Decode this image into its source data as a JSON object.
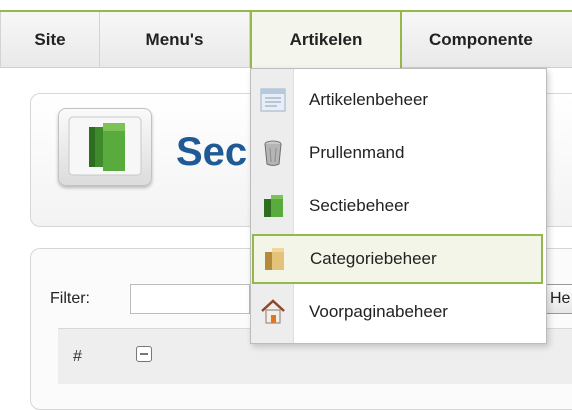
{
  "menubar": {
    "items": [
      {
        "label": "Site"
      },
      {
        "label": "Menu's"
      },
      {
        "label": "Artikelen"
      },
      {
        "label": "Componente"
      }
    ]
  },
  "dropdown": {
    "items": [
      {
        "label": "Artikelenbeheer",
        "icon": "article-manager-icon"
      },
      {
        "label": "Prullenmand",
        "icon": "trash-icon"
      },
      {
        "label": "Sectiebeheer",
        "icon": "section-folder-icon"
      },
      {
        "label": "Categoriebeheer",
        "icon": "category-folder-icon"
      },
      {
        "label": "Voorpaginabeheer",
        "icon": "frontpage-home-icon"
      }
    ]
  },
  "header": {
    "title": "Sec"
  },
  "list": {
    "filter_label": "Filter:",
    "go_label": "He",
    "col_number": "#"
  },
  "colors": {
    "accent": "#94b84c",
    "title": "#1f5a96"
  }
}
